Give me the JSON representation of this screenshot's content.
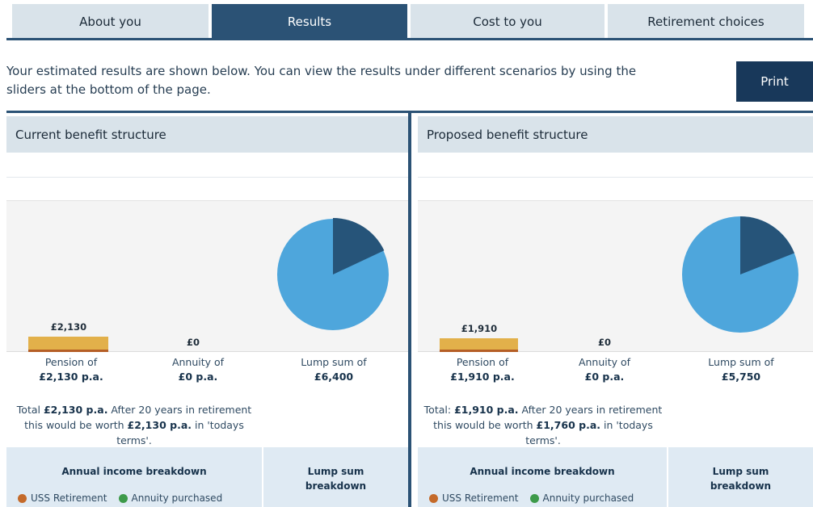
{
  "tabs": [
    {
      "label": "About you",
      "active": false
    },
    {
      "label": "Results",
      "active": true
    },
    {
      "label": "Cost to you",
      "active": false
    },
    {
      "label": "Retirement choices",
      "active": false
    }
  ],
  "intro": "Your estimated results are shown below. You can view the results under different scenarios by using the sliders at the bottom of the page.",
  "print_label": "Print",
  "colors": {
    "primary": "#2b5275",
    "print_button": "#18385a",
    "bar_fill": "#e2b04a",
    "bar_base": "#b55e26",
    "pie_light": "#4ea6dc",
    "pie_dark": "#265479",
    "legend_uss": "#c46a2a",
    "legend_annuity": "#3d9a4a"
  },
  "current": {
    "title": "Current benefit structure",
    "bar_value_label": "£2,130",
    "annuity_value_label": "£0",
    "pension_label": "Pension of",
    "pension_value": "£2,130 p.a.",
    "annuity_label": "Annuity of",
    "annuity_value": "£0 p.a.",
    "lump_label": "Lump sum of",
    "lump_value": "£6,400",
    "pie_dark_fraction": 0.18,
    "total_prefix": "Total",
    "total_value": "£2,130 p.a.",
    "total_middle": "After 20 years in retirement this would be worth",
    "total_worth": "£2,130 p.a.",
    "total_suffix": "in 'todays terms'.",
    "breakdown_title": "Annual income breakdown",
    "lump_breakdown_title": "Lump sum breakdown",
    "legend_uss": "USS Retirement",
    "legend_annuity": "Annuity purchased"
  },
  "proposed": {
    "title": "Proposed benefit structure",
    "bar_value_label": "£1,910",
    "annuity_value_label": "£0",
    "pension_label": "Pension of",
    "pension_value": "£1,910 p.a.",
    "annuity_label": "Annuity of",
    "annuity_value": "£0 p.a.",
    "lump_label": "Lump sum of",
    "lump_value": "£5,750",
    "pie_dark_fraction": 0.19,
    "total_prefix": "Total:",
    "total_value": "£1,910 p.a.",
    "total_middle": "After 20 years in retirement this would be worth",
    "total_worth": "£1,760 p.a.",
    "total_suffix": "in 'todays terms'.",
    "breakdown_title": "Annual income breakdown",
    "lump_breakdown_title": "Lump sum breakdown",
    "legend_uss": "USS Retirement",
    "legend_annuity": "Annuity purchased"
  }
}
